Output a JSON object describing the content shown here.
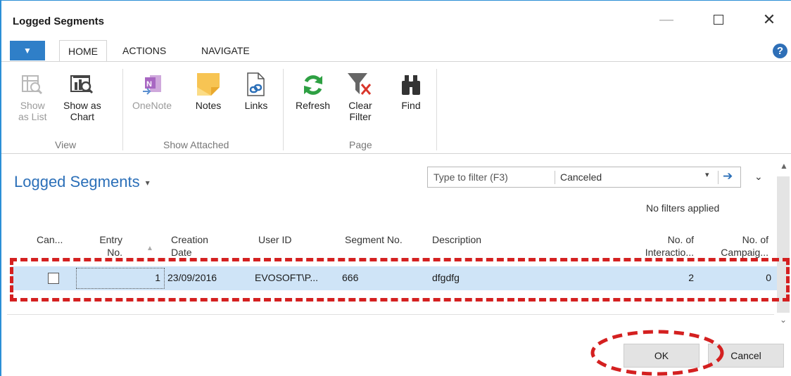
{
  "window": {
    "title": "Logged Segments",
    "controls": {
      "minimize": "—",
      "close": "✕"
    }
  },
  "ribbon": {
    "file_tab_glyph": "▼",
    "tabs": [
      "HOME",
      "ACTIONS",
      "NAVIGATE"
    ],
    "help": "?",
    "groups": [
      {
        "label": "View",
        "buttons": [
          {
            "label": "Show as List",
            "lines": [
              "Show",
              "as List"
            ],
            "icon": "list-grid-icon",
            "enabled": false
          },
          {
            "label": "Show as Chart",
            "lines": [
              "Show as",
              "Chart"
            ],
            "icon": "chart-icon",
            "enabled": true
          }
        ]
      },
      {
        "label": "Show Attached",
        "buttons": [
          {
            "label": "OneNote",
            "icon": "onenote-icon",
            "enabled": false
          },
          {
            "label": "Notes",
            "icon": "notes-icon",
            "enabled": true
          },
          {
            "label": "Links",
            "icon": "links-icon",
            "enabled": true
          }
        ]
      },
      {
        "label": "Page",
        "buttons": [
          {
            "label": "Refresh",
            "icon": "refresh-icon",
            "enabled": true
          },
          {
            "label": "Clear Filter",
            "lines": [
              "Clear",
              "Filter"
            ],
            "icon": "clear-filter-icon",
            "enabled": true
          },
          {
            "label": "Find",
            "icon": "find-binoculars-icon",
            "enabled": true
          }
        ]
      }
    ]
  },
  "page": {
    "title": "Logged Segments",
    "title_caret": "▾",
    "filter": {
      "placeholder": "Type to filter (F3)",
      "field": "Canceled",
      "dropdown_glyph": "▾",
      "go_glyph": "➔"
    },
    "collapse_glyph": "⌄",
    "filter_status": "No filters applied"
  },
  "grid": {
    "columns": [
      {
        "key": "canceled",
        "label": "Can..."
      },
      {
        "key": "entry_no",
        "label": "Entry No.",
        "lines": [
          "Entry",
          "No."
        ],
        "sort": "▲"
      },
      {
        "key": "creation_date",
        "label": "Creation Date",
        "lines": [
          "Creation",
          "Date"
        ]
      },
      {
        "key": "user_id",
        "label": "User ID"
      },
      {
        "key": "segment_no",
        "label": "Segment No."
      },
      {
        "key": "description",
        "label": "Description"
      },
      {
        "key": "no_of_interactions",
        "label": "No. of Interactio...",
        "lines": [
          "No. of",
          "Interactio..."
        ]
      },
      {
        "key": "no_of_campaigns",
        "label": "No. of Campaig...",
        "lines": [
          "No. of",
          "Campaig..."
        ]
      }
    ],
    "rows": [
      {
        "canceled": false,
        "entry_no": "1",
        "creation_date": "23/09/2016",
        "user_id": "EVOSOFT\\P...",
        "segment_no": "666",
        "description": "dfgdfg",
        "no_of_interactions": "2",
        "no_of_campaigns": "0"
      }
    ]
  },
  "scrollbar": {
    "up_glyph": "▲",
    "down_glyph": "⌄"
  },
  "buttons": {
    "ok": "OK",
    "cancel": "Cancel"
  },
  "annotation_color": "#d42020"
}
